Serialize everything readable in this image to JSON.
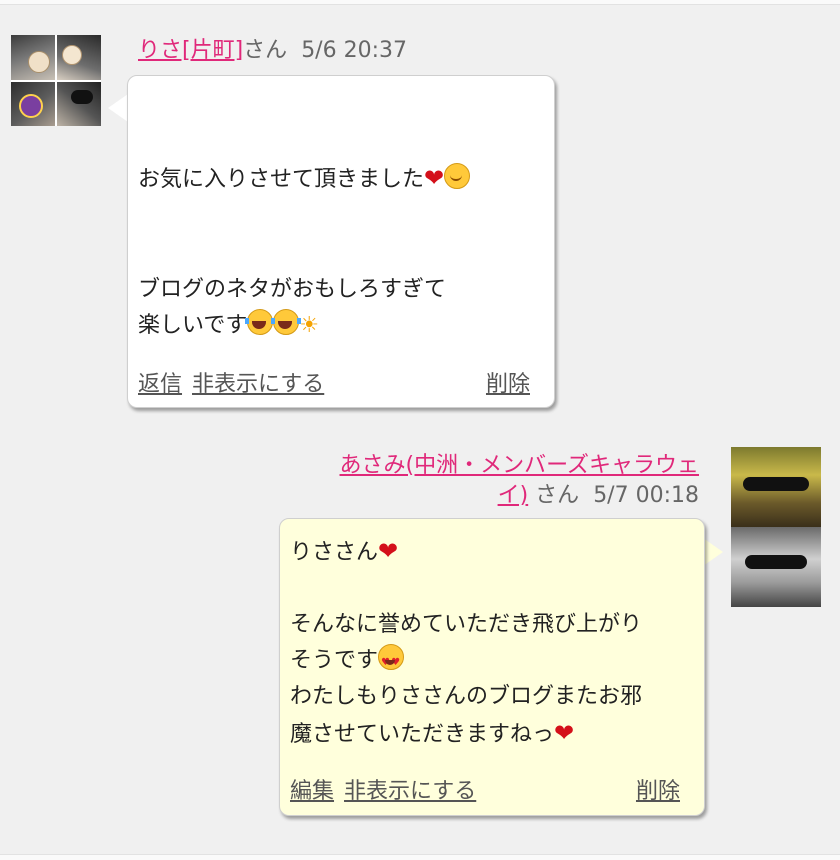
{
  "messages": [
    {
      "name": "りさ[片町]",
      "suffix": "さん",
      "timestamp": "5/6 20:37",
      "line1": "お気に入りさせて頂きました",
      "line2": "ブログのネタがおもしろすぎて",
      "line3": "楽しいです",
      "actions": {
        "reply": "返信",
        "hide": "非表示にする",
        "delete": "削除"
      }
    },
    {
      "name_line1": "あさみ(中洲・メンバーズキャラウェ",
      "name_line2": "イ)",
      "suffix": "さん",
      "timestamp": "5/7 00:18",
      "line1": "りささん",
      "line2": "そんなに誉めていただき飛び上がり",
      "line3": "そうです",
      "line4": "わたしもりささんのブログまたお邪",
      "line5": "魔させていただきますねっ",
      "actions": {
        "edit": "編集",
        "hide": "非表示にする",
        "delete": "削除"
      }
    }
  ],
  "icons": [
    "heart-icon",
    "smile-icon",
    "laugh-cry-icon",
    "sparkle-sun-icon",
    "heart-eyes-icon"
  ],
  "colors": {
    "name_link": "#e0287a",
    "bubble_other": "#ffffff",
    "bubble_self": "#ffffdc",
    "background": "#f0f0f0"
  }
}
